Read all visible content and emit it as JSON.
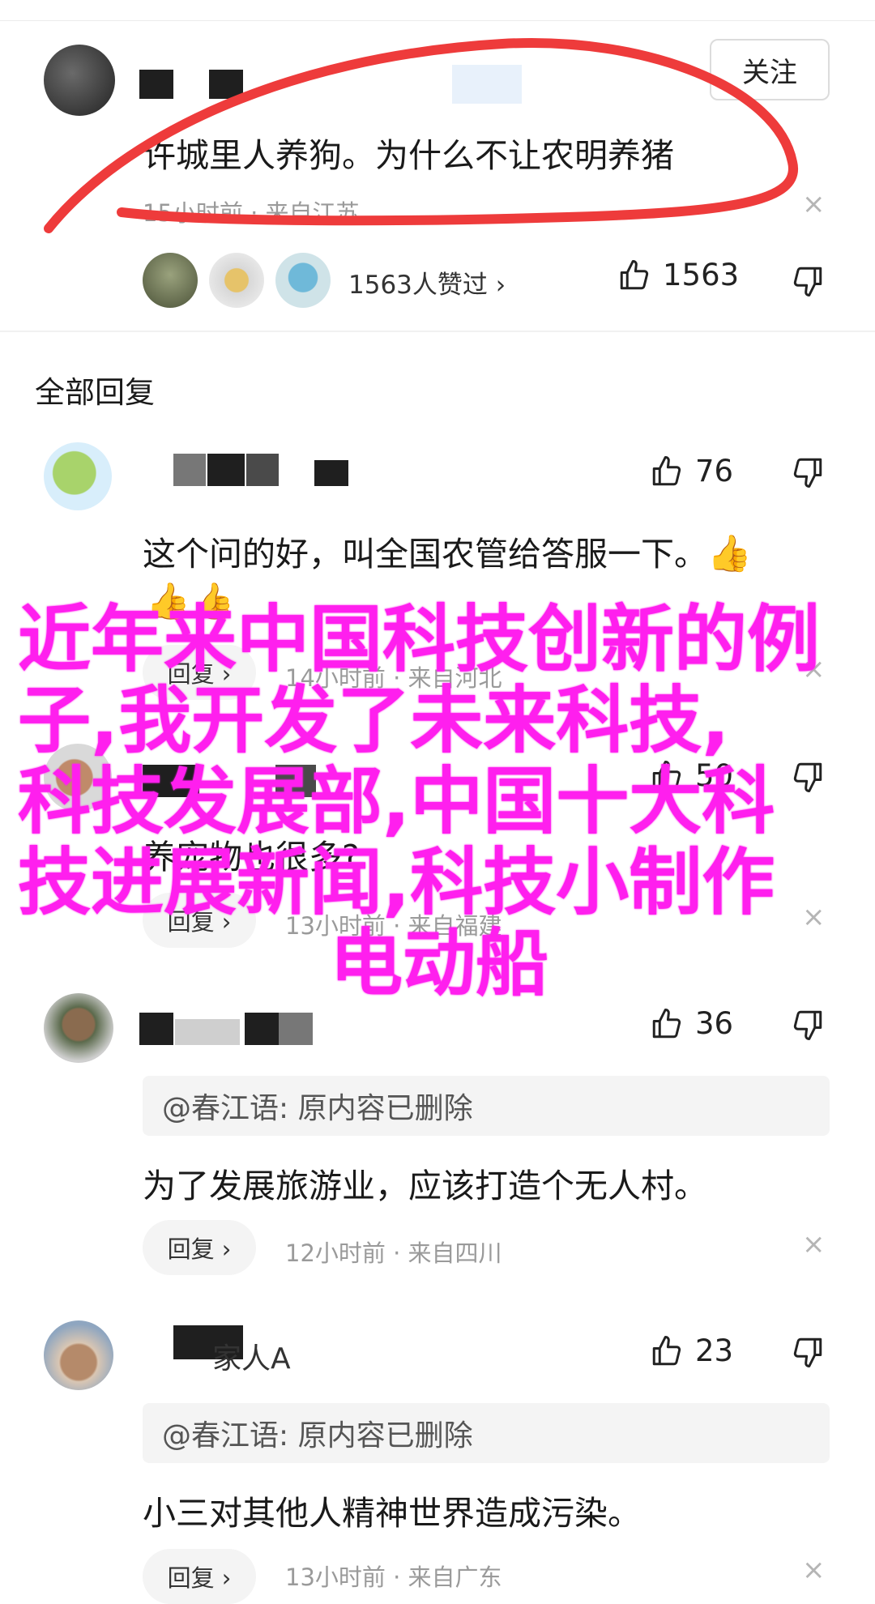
{
  "top_comment": {
    "follow_label": "关注",
    "text": "许城里人养狗。为什么不让农明养猪",
    "meta": "15小时前 · 来自江苏",
    "close": "×",
    "liked_by": "1563人赞过 ›",
    "likes": "1563"
  },
  "section_title": "全部回复",
  "replies": [
    {
      "likes": "76",
      "text": "这个问的好，叫全国农管给答服一下。",
      "emoji_inline": "👍",
      "emoji_line": "👍👍",
      "reply_label": "回复 ›",
      "meta": "14小时前 · 来自河北",
      "close": "×"
    },
    {
      "likes": "50",
      "text": "养宠物也很多?",
      "reply_label": "回复 ›",
      "meta": "13小时前 · 来自福建",
      "close": "×"
    },
    {
      "likes": "36",
      "quote": "@春江语: 原内容已删除",
      "text": "为了发展旅游业，应该打造个无人村。",
      "reply_label": "回复 ›",
      "meta": "12小时前 · 来自四川",
      "close": "×"
    },
    {
      "likes": "23",
      "username": "家人A",
      "quote": "@春江语: 原内容已删除",
      "text": "小三对其他人精神世界造成污染。",
      "reply_label": "回复 ›",
      "meta": "13小时前 · 来自广东",
      "close": "×"
    }
  ],
  "overlay": {
    "line1": "近年来中国科技创新的例",
    "line2": "子,我开发了未来科技,",
    "line3": "科技发展部,中国十大科",
    "line4": "技进展新闻,科技小制作",
    "line5": "电动船"
  },
  "colors": {
    "overlay_text": "#ff1fee",
    "annotation_stroke": "#ee3b3b",
    "muted_text": "#9a9a9a"
  }
}
